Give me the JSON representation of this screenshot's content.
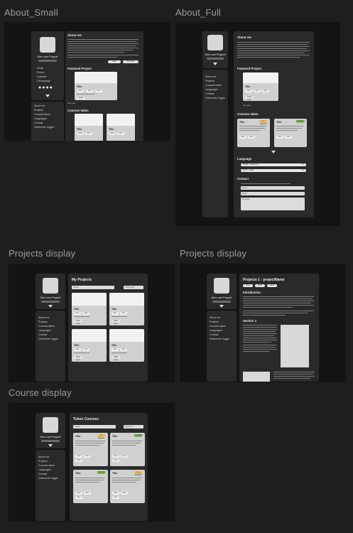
{
  "frames": {
    "about_small": "About_Small",
    "about_full": "About_Full",
    "projects_display_1": "Projects display",
    "projects_display_2": "Projects display",
    "course_display": "Course display"
  },
  "profile": {
    "name": "Alex van Poppel"
  },
  "nav": [
    "About me",
    "Projects",
    "Courses taken",
    "Languages",
    "Contact",
    "Darkmode Toggle"
  ],
  "socials": [
    "Email",
    "Phone",
    "LinkedIn",
    "Githubpage"
  ],
  "about": {
    "heading": "About me",
    "featured": "Featured Project",
    "courses": "Courses taken",
    "language": "Language",
    "contact": "Contact",
    "see_more": "See more",
    "btn1": "label",
    "btn2": "Download"
  },
  "card": {
    "title": "Title",
    "tags": [
      "label",
      "label",
      "label"
    ],
    "more": "Read more",
    "completed": "Completed",
    "in_progress": "In progress"
  },
  "languages": [
    {
      "name": "English - Advanced",
      "level": "C1"
    },
    {
      "name": "Dutch - Native",
      "level": "C2"
    }
  ],
  "contact_fields": [
    "Name",
    "Email",
    "Message"
  ],
  "projects": {
    "heading": "My Projects",
    "search": "Search",
    "filter": "Technology"
  },
  "project_detail": {
    "heading": "Projects 1 - projectName",
    "tabs": [
      "label",
      "label",
      "label"
    ],
    "intro": "Introduction",
    "section": "Section 1"
  },
  "courses_page": {
    "heading": "Token Courses",
    "search": "Search",
    "filter": "Institution"
  },
  "colors": {
    "completed": "#74c04a",
    "in_progress": "#f0b24a"
  }
}
